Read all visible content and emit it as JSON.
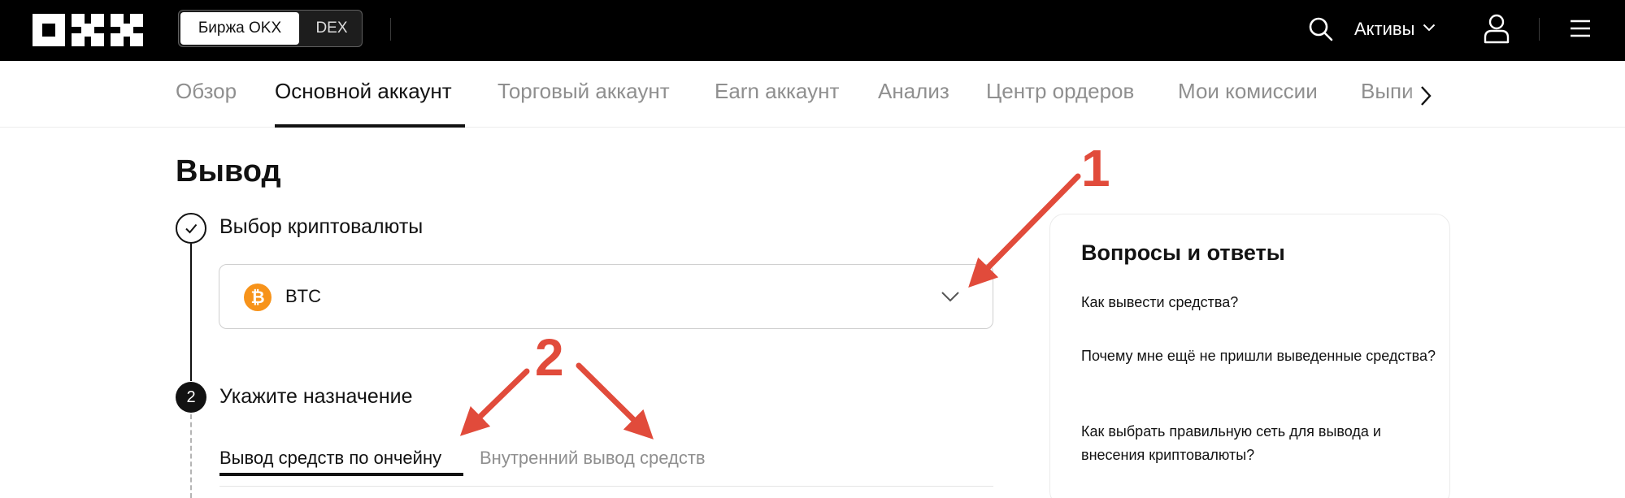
{
  "header": {
    "brand": "OKX",
    "switch_exchange": "Биржа OKX",
    "switch_dex": "DEX",
    "assets_label": "Активы"
  },
  "account_nav": {
    "tabs": [
      {
        "label": "Обзор"
      },
      {
        "label": "Основной аккаунт"
      },
      {
        "label": "Торговый аккаунт"
      },
      {
        "label": "Earn аккаунт"
      },
      {
        "label": "Анализ"
      },
      {
        "label": "Центр ордеров"
      },
      {
        "label": "Мои комиссии"
      },
      {
        "label": "Выпи"
      }
    ],
    "active": "Основной аккаунт"
  },
  "page": {
    "title": "Вывод"
  },
  "steps": {
    "step1": {
      "label": "Выбор криптовалюты"
    },
    "step2": {
      "number": "2",
      "label": "Укажите назначение"
    }
  },
  "coin_select": {
    "selected": "BTC",
    "icon_glyph": "₿",
    "icon_color": "#f7931a"
  },
  "withdraw_tabs": {
    "onchain": "Вывод средств по ончейну",
    "internal": "Внутренний вывод средств"
  },
  "faq": {
    "title": "Вопросы и ответы",
    "items": [
      "Как вывести средства?",
      "Почему мне ещё не пришли выведенные средства?",
      "Как выбрать правильную сеть для вывода и внесения криптовалюты?"
    ]
  },
  "annotations": {
    "marker1": "1",
    "marker2": "2",
    "color": "#e14b3b"
  }
}
